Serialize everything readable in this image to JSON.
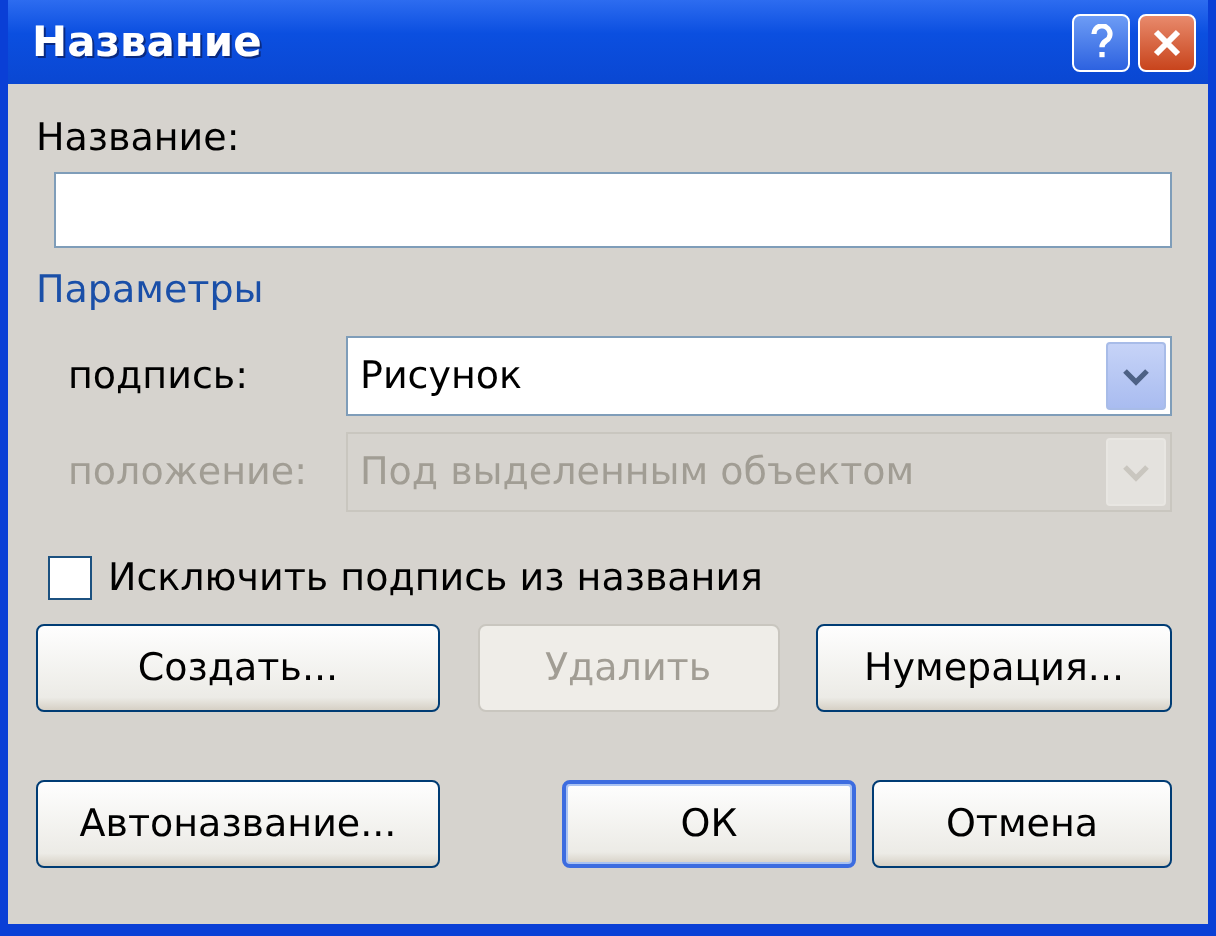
{
  "window": {
    "title": "Название"
  },
  "caption_field": {
    "label": "Название:"
  },
  "group_title": "Параметры",
  "fields": [
    {
      "label": "подпись:",
      "value": "Рисунок",
      "disabled": false
    },
    {
      "label": "положение:",
      "value": "Под выделенным объектом",
      "disabled": true
    }
  ],
  "exclude_checkbox": {
    "label": "Исключить подпись из названия",
    "checked": false
  },
  "button_rows": [
    [
      {
        "label": "Создать...",
        "disabled": false,
        "default": false
      },
      {
        "label": "Удалить",
        "disabled": true,
        "default": false
      },
      {
        "label": "Нумерация...",
        "disabled": false,
        "default": false
      }
    ],
    [
      {
        "label": "Автоназвание...",
        "disabled": false,
        "default": false
      },
      {
        "label": "ОК",
        "disabled": false,
        "default": true
      },
      {
        "label": "Отмена",
        "disabled": false,
        "default": false
      }
    ]
  ]
}
